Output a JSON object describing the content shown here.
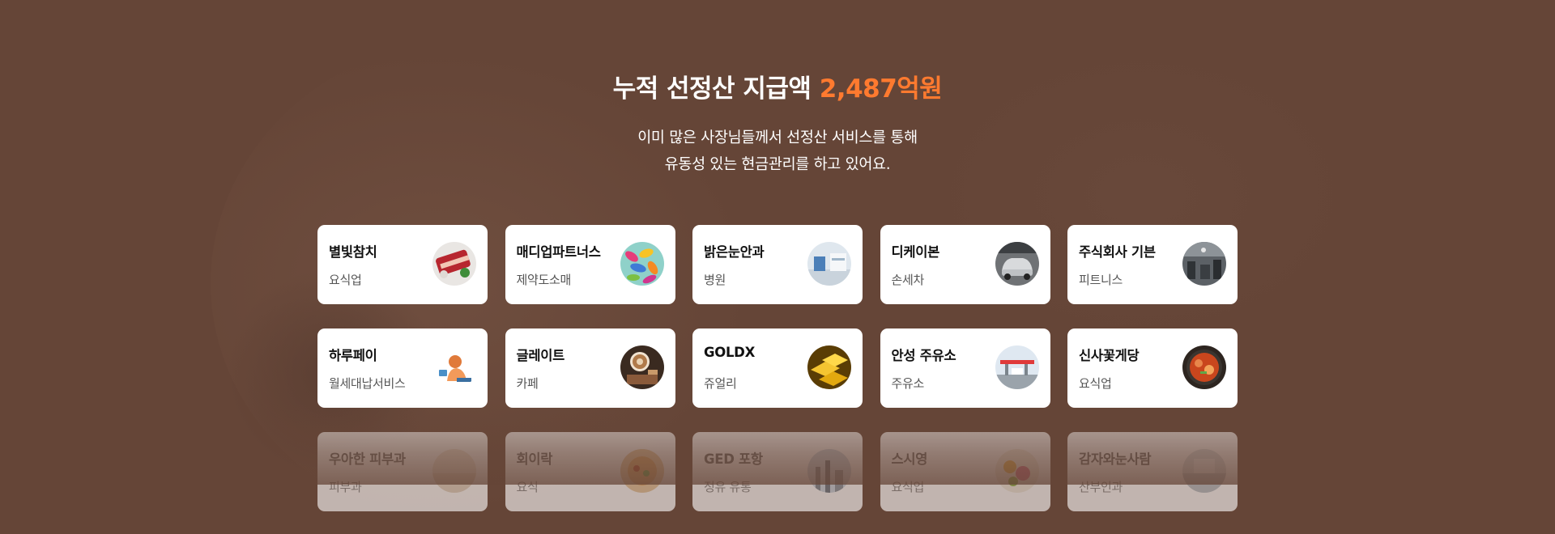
{
  "heading": {
    "prefix": "누적 선정산 지급액",
    "amount": "2,487억원"
  },
  "subtitle": {
    "line1": "이미 많은 사장님들께서 선정산 서비스를 통해",
    "line2": "유동성 있는 현금관리를 하고 있어요."
  },
  "colors": {
    "background": "#654537",
    "accent": "#ff7a2f",
    "card": "#ffffff"
  },
  "rows": [
    [
      {
        "name": "별빛참치",
        "category": "요식업",
        "thumb_icon": "tuna-dish-photo"
      },
      {
        "name": "매디업파트너스",
        "category": "제약도소매",
        "thumb_icon": "pills-photo"
      },
      {
        "name": "밝은눈안과",
        "category": "병원",
        "thumb_icon": "clinic-photo"
      },
      {
        "name": "디케이본",
        "category": "손세차",
        "thumb_icon": "car-wash-photo"
      },
      {
        "name": "주식회사 기븐",
        "category": "피트니스",
        "thumb_icon": "gym-photo"
      }
    ],
    [
      {
        "name": "하루페이",
        "category": "월세대납서비스",
        "thumb_icon": "illustration-photo"
      },
      {
        "name": "글레이트",
        "category": "카페",
        "thumb_icon": "coffee-photo"
      },
      {
        "name": "GOLDX",
        "category": "쥬얼리",
        "thumb_icon": "gold-bars-photo"
      },
      {
        "name": "안성 주유소",
        "category": "주유소",
        "thumb_icon": "gas-station-photo"
      },
      {
        "name": "신사꽃게당",
        "category": "요식업",
        "thumb_icon": "crab-stew-photo"
      }
    ],
    [
      {
        "name": "우아한 피부과",
        "category": "피부과",
        "thumb_icon": "skin-clinic-photo"
      },
      {
        "name": "회이락",
        "category": "요식",
        "thumb_icon": "food-photo"
      },
      {
        "name": "GED 포항",
        "category": "정유 유통",
        "thumb_icon": "plant-photo"
      },
      {
        "name": "스시영",
        "category": "요식업",
        "thumb_icon": "sushi-photo"
      },
      {
        "name": "감자와눈사람",
        "category": "산부인과",
        "thumb_icon": "clinic-photo"
      }
    ]
  ]
}
